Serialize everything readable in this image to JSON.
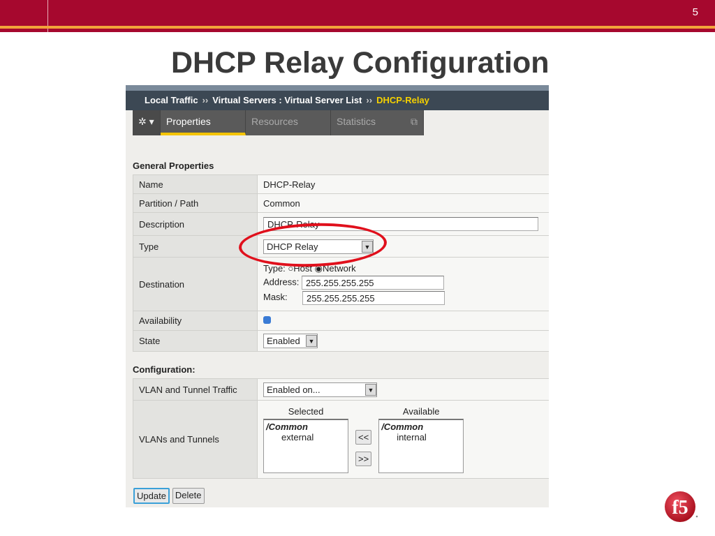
{
  "slide": {
    "page_number": "5",
    "title": "DHCP Relay Configuration",
    "colors": {
      "header": "#a6082e",
      "stripe": "#f2a33a",
      "highlight": "#e0101c"
    }
  },
  "breadcrumb": {
    "items": [
      "Local Traffic",
      "Virtual Servers : Virtual Server List"
    ],
    "current": "DHCP-Relay",
    "separator": "››"
  },
  "tabs": {
    "gear_icon": "gear-icon",
    "items": [
      "Properties",
      "Resources",
      "Statistics"
    ],
    "active": "Properties"
  },
  "general": {
    "heading": "General Properties",
    "name_label": "Name",
    "name": "DHCP-Relay",
    "partition_label": "Partition / Path",
    "partition": "Common",
    "description_label": "Description",
    "description": "DHCP-Relay",
    "type_label": "Type",
    "type": "DHCP Relay",
    "destination_label": "Destination",
    "dest_type_label": "Type:",
    "host": "Host",
    "network": "Network",
    "address_label": "Address:",
    "address": "255.255.255.255",
    "mask_label": "Mask:",
    "mask": "255.255.255.255",
    "availability_label": "Availability",
    "state_label": "State",
    "state": "Enabled"
  },
  "config": {
    "heading": "Configuration:",
    "vlan_traffic_label": "VLAN and Tunnel Traffic",
    "vlan_traffic": "Enabled on...",
    "vlans_label": "VLANs and Tunnels",
    "selected_label": "Selected",
    "available_label": "Available",
    "selected_group": "/Common",
    "selected_items": [
      "external"
    ],
    "available_group": "/Common",
    "available_items": [
      "internal"
    ],
    "move_left": "<<",
    "move_right": ">>"
  },
  "actions": {
    "update": "Update",
    "delete": "Delete"
  },
  "logo": {
    "text": "f5"
  }
}
